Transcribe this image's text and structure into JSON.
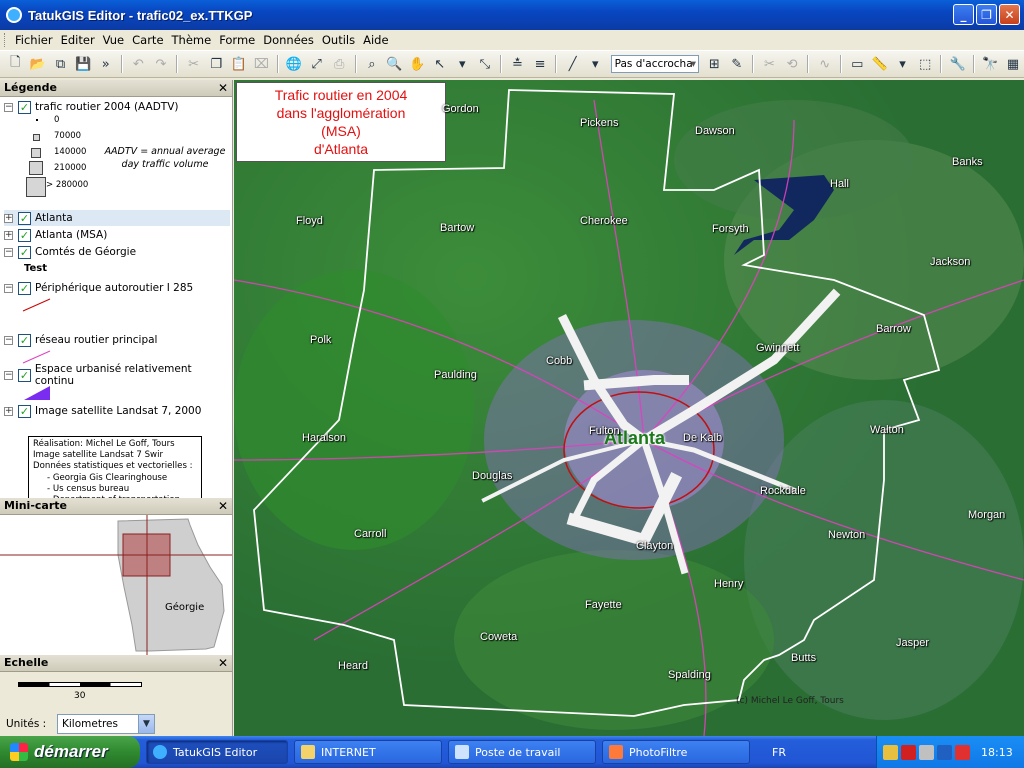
{
  "window": {
    "title": "TatukGIS Editor - trafic02_ex.TTKGP",
    "minimize": "_",
    "maximize": "❐",
    "close": "✕"
  },
  "menu": [
    "Fichier",
    "Editer",
    "Vue",
    "Carte",
    "Thème",
    "Forme",
    "Données",
    "Outils",
    "Aide"
  ],
  "toolbar": {
    "snap_select": "Pas d'accrocha"
  },
  "legend": {
    "title": "Légende",
    "close": "✕",
    "layers": [
      {
        "label": "trafic routier 2004 (AADTV)",
        "checked": true
      },
      {
        "label": "Atlanta",
        "checked": true
      },
      {
        "label": "Atlanta (MSA)",
        "checked": true
      },
      {
        "label": "Comtés de Géorgie",
        "checked": true
      },
      {
        "label": "Périphérique autoroutier  I 285",
        "checked": true
      },
      {
        "label": "réseau routier principal",
        "checked": true
      },
      {
        "label": "Espace urbanisé relativement continu",
        "checked": true
      },
      {
        "label": "Image satellite Landsat 7, 2000",
        "checked": true
      }
    ],
    "traffic_classes": [
      "0",
      "70000",
      "140000",
      "210000",
      "> 280000"
    ],
    "aadtv_note": "AADTV = annual average day traffic volume",
    "test_label": "Test",
    "credits": [
      "Réalisation: Michel Le Goff, Tours",
      "Image satellite Landsat 7 Swir",
      "Données statistiques et vectorielles :",
      "   - Georgia Gis Clearinghouse",
      "   - Us census bureau",
      "   - Department of transportation"
    ]
  },
  "minimap": {
    "title": "Mini-carte",
    "close": "✕",
    "state_label": "Géorgie"
  },
  "scale": {
    "title": "Echelle",
    "close": "✕",
    "value": "30",
    "units_label": "Unités :",
    "units_value": "Kilometres"
  },
  "map": {
    "title_lines": [
      "Trafic routier en 2004",
      "dans l'agglomération",
      "(MSA)",
      "d'Atlanta"
    ],
    "city": "Atlanta",
    "copyright": "(c) Michel Le Goff, Tours",
    "counties": [
      "Gordon",
      "Pickens",
      "Dawson",
      "Banks",
      "Hall",
      "Floyd",
      "Bartow",
      "Cherokee",
      "Forsyth",
      "Jackson",
      "Barrow",
      "Polk",
      "Cobb",
      "Gwinnett",
      "Paulding",
      "Haralson",
      "Fulton",
      "De Kalb",
      "Walton",
      "Douglas",
      "Rockdale",
      "Carroll",
      "Morgan",
      "Clayton",
      "Newton",
      "Henry",
      "Fayette",
      "Coweta",
      "Jasper",
      "Butts",
      "Heard",
      "Spalding"
    ]
  },
  "taskbar": {
    "start": "démarrer",
    "tasks": [
      "TatukGIS Editor",
      "INTERNET",
      "Poste de travail",
      "PhotoFiltre"
    ],
    "lang": "FR",
    "clock": "18:13"
  }
}
